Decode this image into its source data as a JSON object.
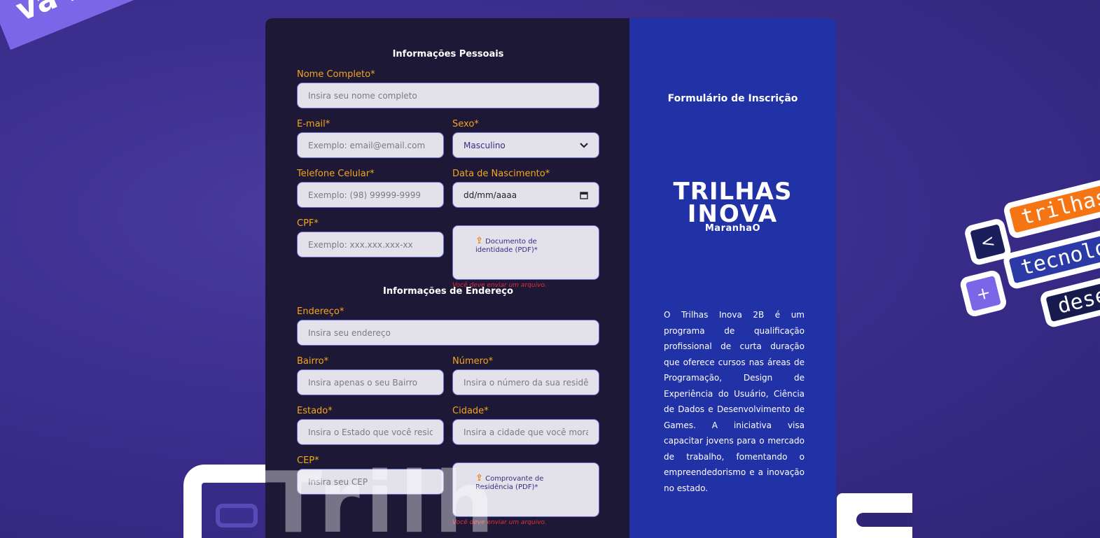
{
  "background": {
    "ribbon_text": "va ma",
    "tags": {
      "t1": "trilhas",
      "t2": "tecnolo",
      "t3": "desen",
      "s1": "<",
      "s2": "+"
    },
    "overlay": "Trilh"
  },
  "form": {
    "personal_title": "Informações Pessoais",
    "name": {
      "label": "Nome Completo*",
      "placeholder": "Insira seu nome completo"
    },
    "email": {
      "label": "E-mail*",
      "placeholder": "Exemplo: email@email.com"
    },
    "sex": {
      "label": "Sexo*",
      "value": "Masculino"
    },
    "phone": {
      "label": "Telefone Celular*",
      "placeholder": "Exemplo: (98) 99999-9999"
    },
    "birth": {
      "label": "Data de Nascimento*",
      "value": "dd/mm/aaaa"
    },
    "cpf": {
      "label": "CPF*",
      "placeholder": "Exemplo: xxx.xxx.xxx-xx"
    },
    "id_doc": {
      "label": "Documento de identidade (PDF)*",
      "error": "Você deve enviar um arquivo."
    },
    "address_title": "Informações de Endereço",
    "address": {
      "label": "Endereço*",
      "placeholder": "Insira seu endereço"
    },
    "district": {
      "label": "Bairro*",
      "placeholder": "Insira apenas o seu Bairro"
    },
    "number": {
      "label": "Número*",
      "placeholder": "Insira o número da sua residência"
    },
    "state": {
      "label": "Estado*",
      "placeholder": "Insira o Estado que você reside"
    },
    "city": {
      "label": "Cidade*",
      "placeholder": "Insira a cidade que você mora"
    },
    "cep": {
      "label": "CEP*",
      "placeholder": "Insira seu CEP"
    },
    "residence_doc": {
      "label": "Comprovante de Residência (PDF)*",
      "error": "Você deve enviar um arquivo."
    }
  },
  "info": {
    "title": "Formulário de Inscrição",
    "logo": {
      "line1": "TRILHAS",
      "line2": "INOVA",
      "line3": "MaranhaO"
    },
    "description": "O Trilhas Inova 2B é um programa de qualificação profissional de curta duração que oferece cursos nas áreas de Programação, Design de Experiência do Usuário, Ciência de Dados e Desenvolvimento de Games. A iniciativa visa capacitar jovens para o mercado de trabalho, fomentando o empreendedorismo e a inovação no estado."
  },
  "colors": {
    "label": "#f4a51c",
    "form_bg": "#1e1837",
    "info_bg": "#2131a6",
    "error": "#e0303a",
    "upload_icon": "#f07a14"
  },
  "icons": {
    "upload": "upload-icon",
    "chevron": "chevron-down-icon",
    "calendar": "calendar-icon"
  }
}
